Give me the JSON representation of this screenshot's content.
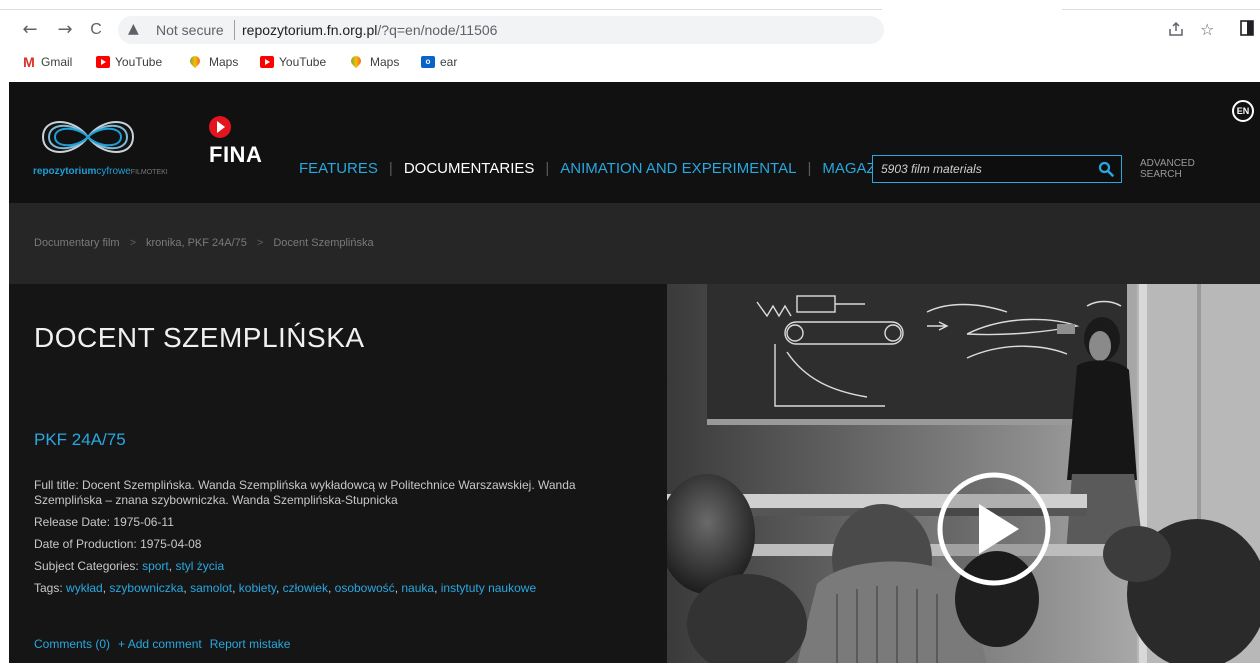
{
  "browser": {
    "nav": {
      "back": "←",
      "forward": "→",
      "reload": "C"
    },
    "address": {
      "security_label": "Not secure",
      "host": "repozytorium.fn.org.pl",
      "path": "/?q=en/node/11506"
    },
    "bookmarks": [
      {
        "label": "Gmail",
        "icon": "gmail-icon"
      },
      {
        "label": "YouTube",
        "icon": "youtube-icon"
      },
      {
        "label": "Maps",
        "icon": "maps-icon"
      },
      {
        "label": "YouTube",
        "icon": "youtube-icon"
      },
      {
        "label": "Maps",
        "icon": "maps-icon"
      },
      {
        "label": "ear",
        "icon": "outlook-icon"
      }
    ]
  },
  "site": {
    "logo": {
      "word_bold": "repozytorium",
      "word_light": "cyfrowe",
      "word_small": "FILMOTEKI"
    },
    "fina": {
      "word": "FINA"
    },
    "lang": "EN",
    "nav": [
      {
        "label": "FEATURES",
        "active": false
      },
      {
        "label": "DOCUMENTARIES",
        "active": true
      },
      {
        "label": "ANIMATION AND EXPERIMENTAL",
        "active": false
      },
      {
        "label": "MAGAZINE",
        "active": false
      }
    ],
    "search": {
      "placeholder": "5903 film materials",
      "advanced": "ADVANCED\nSEARCH"
    },
    "breadcrumb": [
      "Documentary film",
      "kronika, PKF 24A/75",
      "Docent Szemplińska"
    ],
    "film": {
      "title": "DOCENT SZEMPLIŃSKA",
      "series": "PKF 24A/75",
      "full_title_label": "Full title:",
      "full_title": "Docent Szemplińska. Wanda Szemplińska wykładowcą w Politechnice Warszawskiej. Wanda Szemplińska – znana szybowniczka. Wanda Szemplińska-Stupnicka",
      "release_label": "Release Date:",
      "release": "1975-06-11",
      "production_label": "Date of Production:",
      "production": "1975-04-08",
      "subjects_label": "Subject Categories:",
      "subjects": [
        "sport",
        "styl życia"
      ],
      "tags_label": "Tags:",
      "tags": [
        "wykład",
        "szybowniczka",
        "samolot",
        "kobiety",
        "człowiek",
        "osobowość",
        "nauka",
        "instytuty naukowe"
      ]
    },
    "actions": {
      "comments": "Comments (0)",
      "add_comment": "+ Add comment",
      "report": "Report mistake"
    }
  },
  "colors": {
    "accent": "#29a7df",
    "header_bg": "#111111",
    "crumb_bg": "#262626",
    "content_bg": "#151515",
    "fina_red": "#e3141d"
  }
}
